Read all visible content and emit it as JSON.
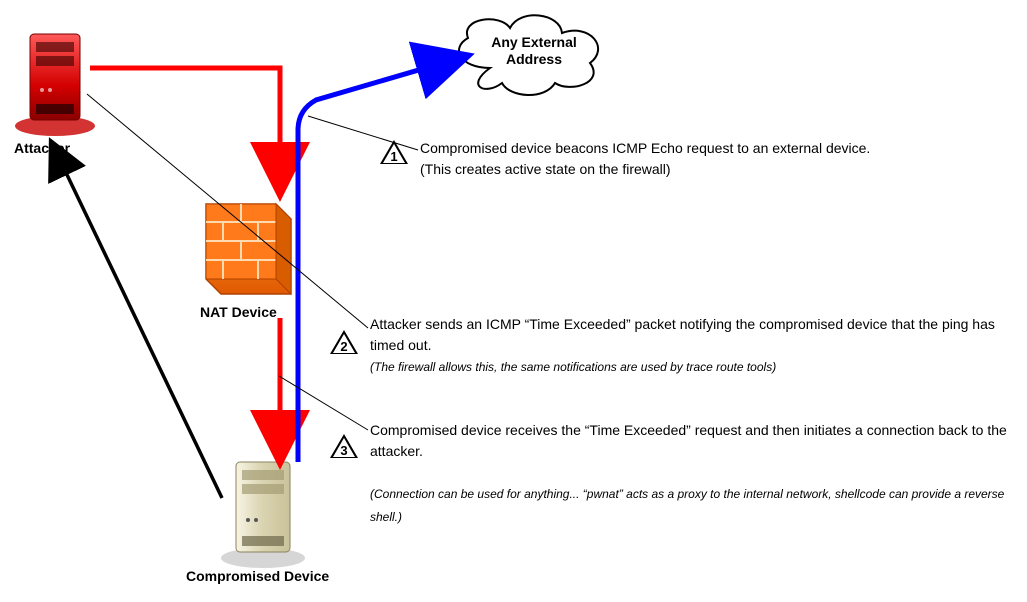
{
  "nodes": {
    "attacker": {
      "label": "Attacker"
    },
    "cloud": {
      "line1": "Any External",
      "line2": "Address"
    },
    "nat": {
      "label": "NAT Device"
    },
    "compromised": {
      "label": "Compromised Device"
    }
  },
  "steps": {
    "s1": {
      "num": "1",
      "line1": "Compromised device beacons ICMP Echo request to an external device.",
      "line2": "(This creates active state on the firewall)"
    },
    "s2": {
      "num": "2",
      "line1": "Attacker sends an ICMP “Time Exceeded” packet notifying the compromised device that the ping has timed out.",
      "line2": "(The firewall allows this, the same notifications are used by trace route tools)"
    },
    "s3": {
      "num": "3",
      "line1": "Compromised device receives the “Time Exceeded” request and then initiates a connection back to the attacker.",
      "line2": "(Connection can be used for anything... “pwnat” acts as a proxy to the internal network, shellcode can provide a reverse shell.)"
    }
  }
}
